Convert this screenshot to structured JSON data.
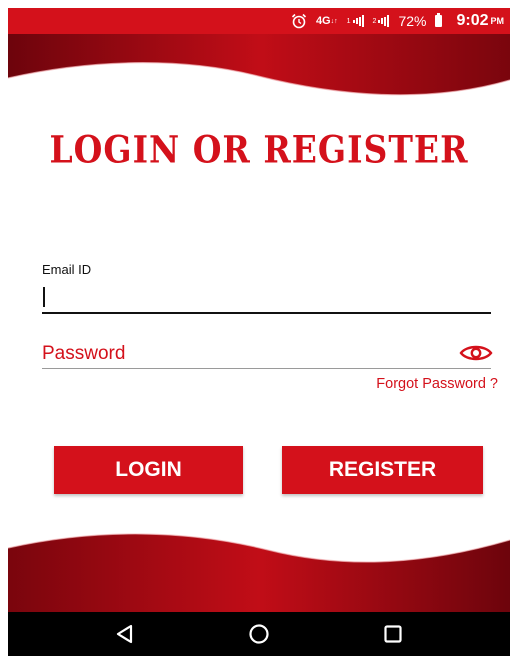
{
  "status_bar": {
    "network": "4G",
    "sim1": "1",
    "sim2": "2",
    "battery": "72%",
    "time": "9:02",
    "ampm": "PM",
    "icons": [
      "alarm-icon",
      "data-arrows-icon",
      "signal-icon",
      "signal-icon",
      "battery-icon"
    ]
  },
  "page": {
    "title": "LOGIN OR REGISTER"
  },
  "form": {
    "email_label": "Email ID",
    "email_value": "",
    "password_placeholder": "Password",
    "forgot_label": "Forgot Password ?"
  },
  "buttons": {
    "login": "LOGIN",
    "register": "REGISTER"
  },
  "colors": {
    "accent": "#d4111b",
    "wave_dark": "#8a0610",
    "nav_bg": "#000000"
  },
  "nav": {
    "icons": [
      "back-icon",
      "home-icon",
      "recents-icon"
    ]
  }
}
